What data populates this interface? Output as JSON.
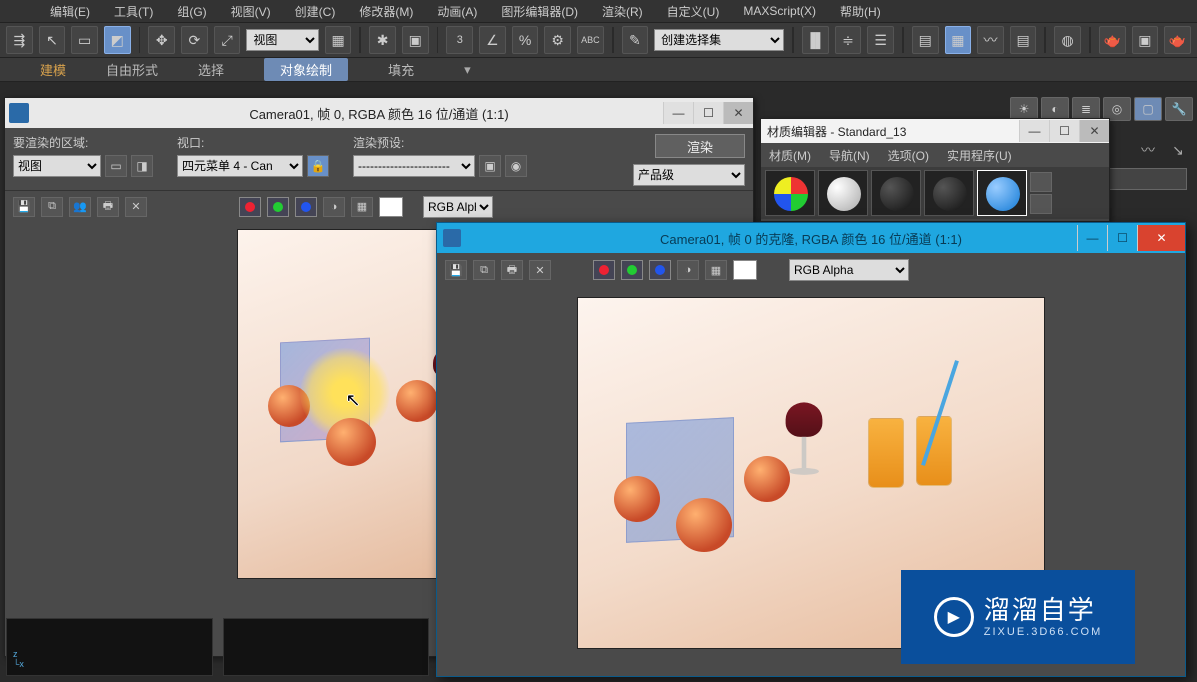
{
  "menu": {
    "items": [
      "编辑(E)",
      "工具(T)",
      "组(G)",
      "视图(V)",
      "创建(C)",
      "修改器(M)",
      "动画(A)",
      "图形编辑器(D)",
      "渲染(R)",
      "自定义(U)",
      "MAXScript(X)",
      "帮助(H)"
    ]
  },
  "main_toolbar": {
    "view_select": "视图",
    "named_set": "创建选择集"
  },
  "ribbon": {
    "tabs": [
      "建模",
      "自由形式",
      "选择",
      "对象绘制",
      "填充"
    ],
    "active_index": 3
  },
  "rfw1": {
    "title": "Camera01, 帧 0, RGBA 颜色 16 位/通道 (1:1)",
    "area_label": "要渲染的区域:",
    "area_select": "视图",
    "viewport_label": "视口:",
    "viewport_select": "四元菜单 4 - Can",
    "preset_label": "渲染预设:",
    "preset_select": "-----------------------",
    "prod_select": "产品级",
    "render_btn": "渲染",
    "rgb_select": "RGB Alpha"
  },
  "mat_editor": {
    "title": "材质编辑器 - Standard_13",
    "menu": [
      "材质(M)",
      "导航(N)",
      "选项(O)",
      "实用程序(U)"
    ]
  },
  "rfw2": {
    "title": "Camera01, 帧 0 的克隆, RGBA 颜色 16 位/通道 (1:1)",
    "rgb_select": "RGB Alpha"
  },
  "watermark": {
    "brand": "溜溜自学",
    "url": "ZIXUE.3D66.COM"
  }
}
